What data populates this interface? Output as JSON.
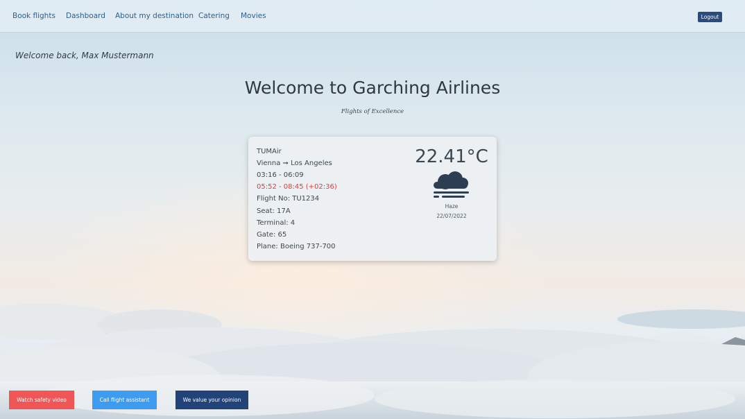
{
  "nav": {
    "links": [
      "Book flights",
      "Dashboard",
      "About my destination",
      "Catering",
      "Movies"
    ],
    "logout_label": "Logout"
  },
  "header": {
    "welcome_back": "Welcome back, Max Mustermann",
    "title": "Welcome to Garching Airlines",
    "subtitle": "Flights of Excellence"
  },
  "flight": {
    "airline": "TUMAir",
    "origin": "Vienna",
    "arrow": "➞",
    "destination": "Los Angeles",
    "scheduled_time": "03:16 - 06:09",
    "actual_time": "05:52 - 08:45 (+02:36)",
    "flight_no": "Flight No: TU1234",
    "seat": "Seat: 17A",
    "terminal": "Terminal: 4",
    "gate": "Gate: 65",
    "plane": "Plane: Boeing 737-700"
  },
  "weather": {
    "temperature": "22.41°C",
    "condition": "Haze",
    "date": "22/07/2022",
    "icon": "haze-cloud-icon",
    "icon_color": "#2e3e52"
  },
  "actions": {
    "safety_video": "Watch safety video",
    "call_assistant": "Call flight assistant",
    "feedback": "We value your opinion"
  },
  "colors": {
    "logout_bg": "#2a4b7c",
    "delay_text": "#e03b3b",
    "btn_red": "#f15656",
    "btn_blue": "#3d9cf0",
    "btn_navy": "#22427a",
    "nav_link": "#2f5f8c"
  }
}
